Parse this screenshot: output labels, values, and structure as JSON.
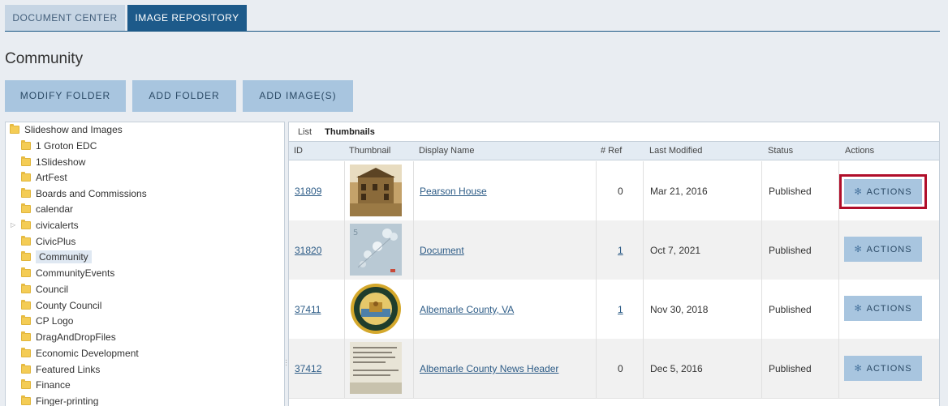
{
  "tabs": [
    {
      "label": "DOCUMENT CENTER"
    },
    {
      "label": "IMAGE REPOSITORY"
    }
  ],
  "page_title": "Community",
  "toolbar": {
    "modify_folder": "MODIFY FOLDER",
    "add_folder": "ADD FOLDER",
    "add_images": "ADD IMAGE(S)"
  },
  "tree": {
    "root": "Slideshow and Images",
    "items": [
      {
        "label": "1 Groton EDC"
      },
      {
        "label": "1Slideshow"
      },
      {
        "label": "ArtFest"
      },
      {
        "label": "Boards and Commissions"
      },
      {
        "label": "calendar"
      },
      {
        "label": "civicalerts"
      },
      {
        "label": "CivicPlus"
      },
      {
        "label": "Community"
      },
      {
        "label": "CommunityEvents"
      },
      {
        "label": "Council"
      },
      {
        "label": "County Council"
      },
      {
        "label": "CP Logo"
      },
      {
        "label": "DragAndDropFiles"
      },
      {
        "label": "Economic Development"
      },
      {
        "label": "Featured Links"
      },
      {
        "label": "Finance"
      },
      {
        "label": "Finger-printing"
      }
    ]
  },
  "view_tabs": {
    "list": "List",
    "thumbnails": "Thumbnails"
  },
  "columns": {
    "id": "ID",
    "thumbnail": "Thumbnail",
    "display_name": "Display Name",
    "ref": "# Ref",
    "last_modified": "Last Modified",
    "status": "Status",
    "actions": "Actions"
  },
  "rows": [
    {
      "id": "31809",
      "name": "Pearson House",
      "ref": "0",
      "modified": "Mar 21, 2016",
      "status": "Published",
      "action": "ACTIONS"
    },
    {
      "id": "31820",
      "name": "Document",
      "ref": "1",
      "modified": "Oct 7, 2021",
      "status": "Published",
      "action": "ACTIONS"
    },
    {
      "id": "37411",
      "name": "Albemarle County, VA",
      "ref": "1",
      "modified": "Nov 30, 2018",
      "status": "Published",
      "action": "ACTIONS"
    },
    {
      "id": "37412",
      "name": "Albemarle County News Header",
      "ref": "0",
      "modified": "Dec 5, 2016",
      "status": "Published",
      "action": "ACTIONS"
    }
  ],
  "colors": {
    "accent": "#1d5a8a",
    "button": "#a8c5df",
    "highlight": "#b00e2a",
    "folder": "#f4cc55"
  }
}
